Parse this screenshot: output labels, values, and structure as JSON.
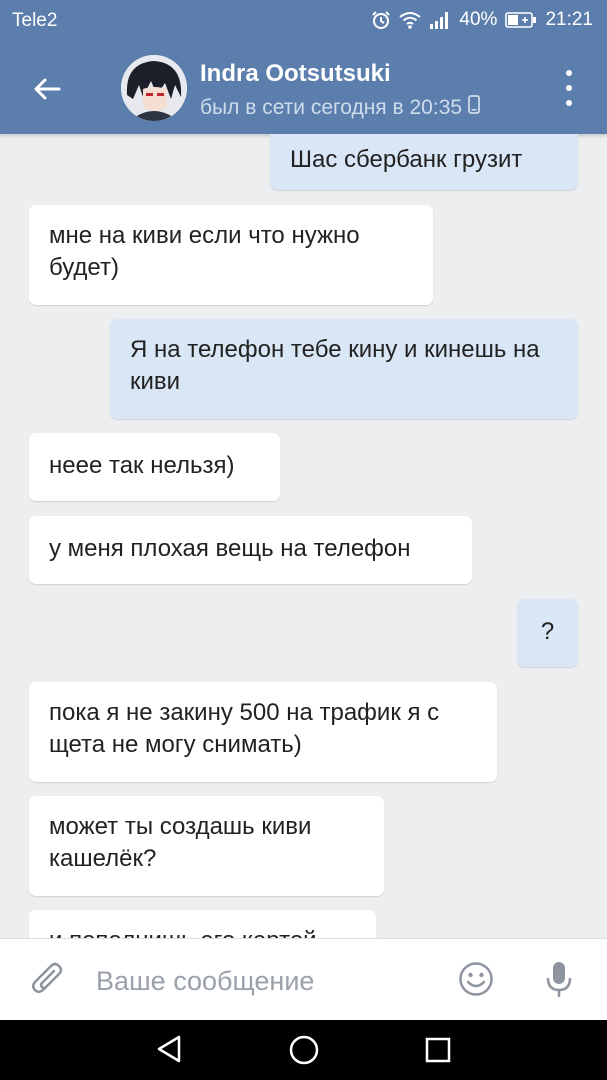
{
  "status_bar": {
    "carrier": "Tele2",
    "battery": "40%",
    "time": "21:21"
  },
  "header": {
    "contact_name": "Indra Ootsutsuki",
    "last_seen": "был в сети сегодня в 20:35"
  },
  "messages": [
    {
      "direction": "out",
      "text": "Шас сбербанк грузит"
    },
    {
      "direction": "in",
      "text": "мне на киви если что нужно будет)"
    },
    {
      "direction": "out",
      "text": "Я на телефон тебе кину и кинешь на киви"
    },
    {
      "direction": "in",
      "text": "неее так нельзя)"
    },
    {
      "direction": "in",
      "text": "у меня плохая вещь на телефон"
    },
    {
      "direction": "out",
      "text": "?"
    },
    {
      "direction": "in",
      "text": "пока я не закину 500 на трафик я с щета не могу снимать)"
    },
    {
      "direction": "in",
      "text": "может ты создашь киви кашелёк?"
    },
    {
      "direction": "in",
      "text": "и пополнишь его картой"
    }
  ],
  "composer": {
    "placeholder": "Ваше сообщение"
  },
  "colors": {
    "header": "#5b7ead",
    "chat_background": "#edeef0",
    "incoming_bubble": "#ffffff",
    "outgoing_bubble": "#d9e6f5"
  },
  "icons": [
    "alarm-icon",
    "wifi-icon",
    "signal-icon",
    "battery-icon",
    "back-arrow-icon",
    "more-vertical-icon",
    "phone-icon",
    "paperclip-icon",
    "smile-icon",
    "microphone-icon",
    "nav-back-icon",
    "nav-home-icon",
    "nav-recents-icon"
  ]
}
